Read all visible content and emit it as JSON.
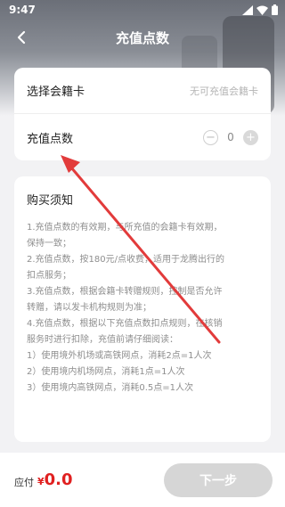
{
  "status_bar": {
    "time": "9:47"
  },
  "header": {
    "title": "充值点数"
  },
  "membership": {
    "label": "选择会籍卡",
    "value": "无可充值会籍卡"
  },
  "points": {
    "label": "充值点数",
    "minus": "−",
    "quantity": "0",
    "plus": "+"
  },
  "notice": {
    "title": "购买须知",
    "lines": [
      "1.充值点数的有效期，与所充值的会籍卡有效期，",
      "保持一致；",
      "2.充值点数，按180元/点收费，适用于龙腾出行的",
      "扣点服务；",
      "3.充值点数，根据会籍卡转赠规则，控制是否允许",
      "转赠，请以发卡机构规则为准；",
      "4.充值点数，根据以下充值点数扣点规则，在核销",
      "服务时进行扣除，充值前请仔细阅读：",
      "1）使用境外机场或高铁网点，消耗2点=1人次",
      "2）使用境内机场网点，消耗1点=1人次",
      "3）使用境内高铁网点，消耗0.5点=1人次"
    ]
  },
  "footer": {
    "pay_label": "应付",
    "currency": "¥",
    "amount": "0.0",
    "next_label": "下一步"
  },
  "colors": {
    "price": "#e02020",
    "annotation_arrow": "#e23b3b"
  },
  "icons": [
    "back-arrow-icon",
    "signal-icon",
    "wifi-icon",
    "battery-icon",
    "annotation-arrow-icon"
  ]
}
